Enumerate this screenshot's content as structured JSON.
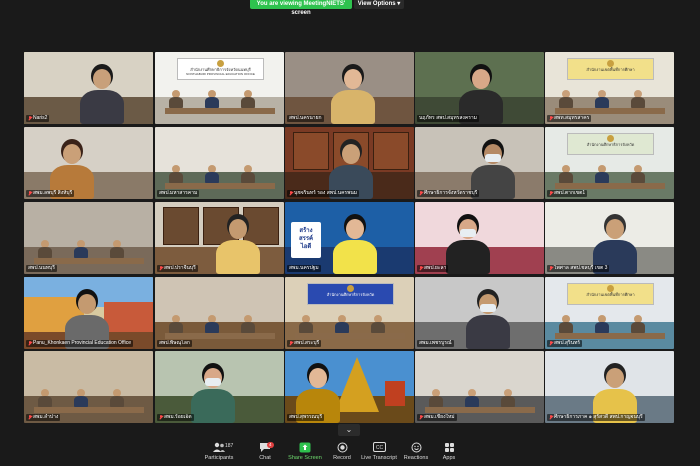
{
  "banner": {
    "viewing_text": "You are viewing MeetingNIETS' screen",
    "view_options_label": "View Options",
    "view_options_caret": "▾"
  },
  "tiles": [
    {
      "label": "Naris2",
      "muted": true
    },
    {
      "label": "",
      "muted": false
    },
    {
      "label": "สพป.นครนายก",
      "muted": false
    },
    {
      "label": "นฤภัทร สพป.สมุทรสงคราม",
      "muted": false
    },
    {
      "label": "สพท.สมุทรสาคร",
      "muted": true
    },
    {
      "label": "สพม.ลพบุรี สิงห์บุรี",
      "muted": true
    },
    {
      "label": "สพป.มหาสารคาม",
      "muted": false
    },
    {
      "label": "นุชจรินทร์ รอง สพป.นครพนม",
      "muted": true
    },
    {
      "label": "ศึกษาธิการจังหวัดราชบุรี",
      "muted": true
    },
    {
      "label": "สพป.ตากเขต1",
      "muted": true
    },
    {
      "label": "สพป.นนทบุรี",
      "muted": false
    },
    {
      "label": "สพป.ปราจีนบุรี",
      "muted": true
    },
    {
      "label": "สพม.นครปฐม",
      "muted": false
    },
    {
      "label": "สพป.ยะลา",
      "muted": true
    },
    {
      "label": "ไพศาล สพป.ชลบุรี เขต 3",
      "muted": true
    },
    {
      "label": "Panu_Khonkaen Provincial Education Office",
      "muted": true
    },
    {
      "label": "สพป.พิษณุโลก",
      "muted": false
    },
    {
      "label": "สพป.สระบุรี",
      "muted": true
    },
    {
      "label": "สพม.เพชรบูรณ์",
      "muted": false
    },
    {
      "label": "สพป.สุรินทร์",
      "muted": true
    },
    {
      "label": "สพม.ลำปาง",
      "muted": true
    },
    {
      "label": "สพม.ร้อยเอ็ด",
      "muted": true
    },
    {
      "label": "สพป.สุพรรณบุรี",
      "muted": false
    },
    {
      "label": "สพม.เชียงใหม่",
      "muted": true
    },
    {
      "label": "ศึกษาธิการภาค ๑ สุรัสวดี สพป.กาญจนบุรี",
      "muted": true
    }
  ],
  "signs": {
    "nonthaburi_line1": "สำนักงานศึกษาธิการจังหวัดนนทบุรี",
    "nonthaburi_line2": "NONTHABURI PROVINCIAL EDUCATION OFFICE",
    "sign_green_line": "สำนักงานศึกษาธิการจังหวัด",
    "sign_yellow_line": "สำนักงานเขตพื้นที่การศึกษา",
    "blue_screen_line": "สำนักงานศึกษาธิการจังหวัด",
    "poster_line1": "สร้าง",
    "poster_line2": "สรรค์",
    "poster_line3": "ไอดี"
  },
  "toolbar": {
    "participants_count": "187",
    "participants_label": "Participants",
    "chat_badge": "4",
    "chat_label": "Chat",
    "share_label": "Share Screen",
    "record_label": "Record",
    "transcript_label": "Live Transcript",
    "reactions_label": "Reactions",
    "apps_label": "Apps"
  },
  "colors": {
    "share_green": "#2ec24e",
    "active_border": "#c8e84a",
    "chat_badge": "#e04040",
    "muted_red": "#ff4a4a"
  },
  "icons": {
    "participants": "participants-icon",
    "chat": "chat-icon",
    "share": "share-screen-icon",
    "record": "record-icon",
    "transcript": "cc-icon",
    "reactions": "reactions-icon",
    "apps": "apps-icon",
    "chevron": "chevron-down-icon"
  }
}
